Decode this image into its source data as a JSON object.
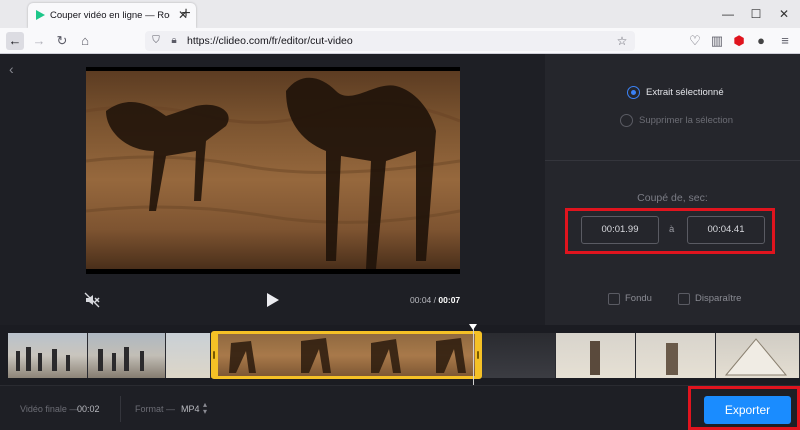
{
  "browser": {
    "tab_title": "Couper vidéo en ligne — Rogner",
    "new_tab_label": "+",
    "url": "https://clideo.com/fr/editor/cut-video",
    "window_minimize": "—",
    "window_maximize": "☐",
    "window_close": "✕"
  },
  "player": {
    "time_current": "00:04",
    "time_separator": "/",
    "time_total": "00:07"
  },
  "options": {
    "radio_selected": "Extrait sélectionné",
    "radio_delete": "Supprimer la sélection",
    "cut_label": "Coupé de, sec:",
    "start_time": "00:01.99",
    "to_label": "à",
    "end_time": "00:04.41",
    "checkbox_fade": "Fondu",
    "checkbox_disappear": "Disparaître"
  },
  "bottom": {
    "final_video_label": "Vidéo finale —",
    "final_video_value": "00:02",
    "format_label": "Format —",
    "format_value": "MP4",
    "export_label": "Exporter"
  },
  "colors": {
    "accent": "#1a8cff",
    "selection": "#f5c126",
    "highlight_box": "#e0141e"
  }
}
